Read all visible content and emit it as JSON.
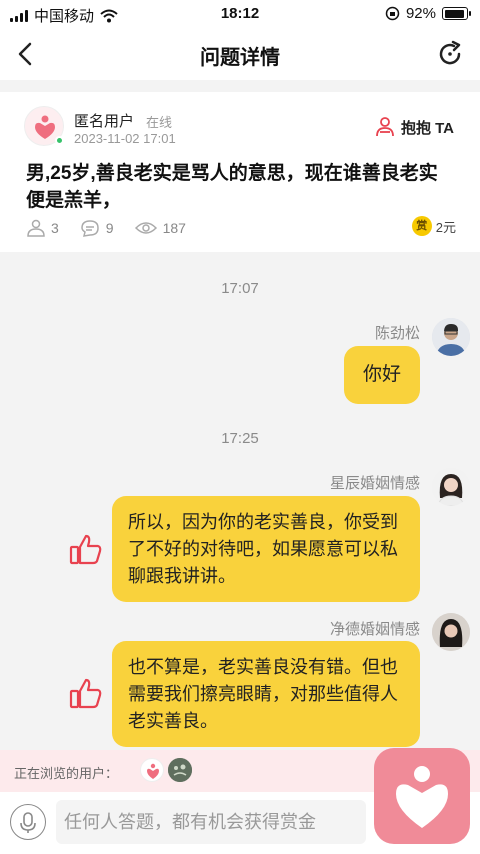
{
  "status_bar": {
    "carrier": "中国移动",
    "time": "18:12",
    "battery": "92%",
    "battery_level": 0.92
  },
  "nav": {
    "title": "问题详情"
  },
  "question": {
    "user_name": "匿名用户",
    "user_status": "在线",
    "post_time": "2023-11-02 17:01",
    "hug_label": "抱抱 TA",
    "text": "男,25岁,善良老实是骂人的意思，现在谁善良老实便是羔羊，",
    "hugs_count": "3",
    "comments_count": "9",
    "views_count": "187",
    "reward_badge": "赏",
    "reward_amount": "2元"
  },
  "chat": [
    {
      "time": "17:07",
      "sender": "陈劲松",
      "message": "你好"
    },
    {
      "time": "17:25",
      "sender": "星辰婚姻情感",
      "message": "所以，因为你的老实善良，你受到了不好的对待吧，如果愿意可以私聊跟我讲讲。"
    },
    {
      "sender": "净德婚姻情感",
      "message": "也不算是，老实善良没有错。但也需要我们擦亮眼睛，对那些值得人老实善良。"
    }
  ],
  "browsing": {
    "label": "正在浏览的用户："
  },
  "input": {
    "placeholder": "任何人答题，都有机会获得赏金"
  },
  "colors": {
    "bubble": "#f9d23c",
    "accent_red": "#e8424f",
    "browsing_bg": "#fdeaec",
    "app_pink": "#f08b98"
  }
}
